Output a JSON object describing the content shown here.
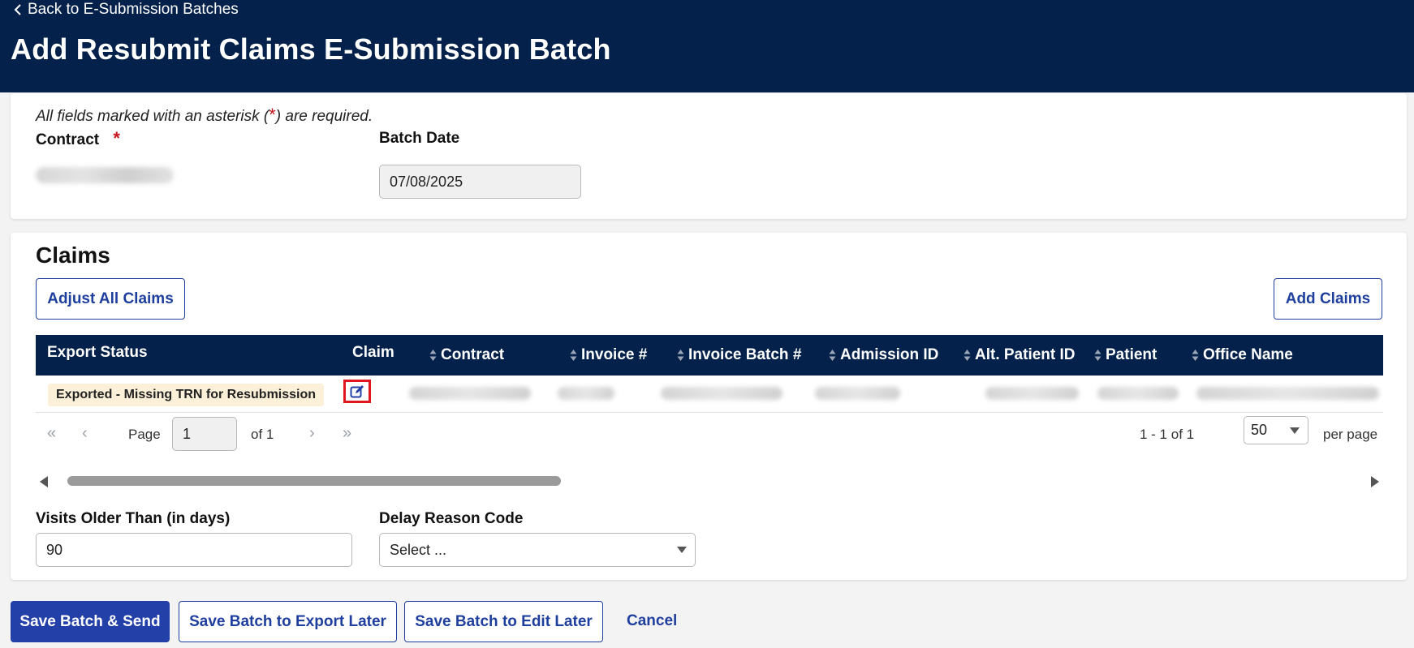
{
  "header": {
    "back_link": "Back to E-Submission Batches",
    "title": "Add Resubmit Claims E-Submission Batch"
  },
  "form": {
    "required_note_prefix": "All fields marked with an asterisk (",
    "required_note_asterisk": "*",
    "required_note_suffix": ") are required.",
    "contract_label": "Contract",
    "contract_required": "*",
    "batch_date_label": "Batch Date",
    "batch_date_value": "07/08/2025"
  },
  "claims": {
    "title": "Claims",
    "adjust_all_label": "Adjust All Claims",
    "add_claims_label": "Add Claims",
    "columns": [
      "Export Status",
      "Claim",
      "Contract",
      "Invoice #",
      "Invoice Batch #",
      "Admission ID",
      "Alt. Patient ID",
      "Patient",
      "Office Name"
    ],
    "rows": [
      {
        "export_status": "Exported - Missing TRN for Resubmission"
      }
    ],
    "pagination": {
      "page_label": "Page",
      "page_value": "1",
      "of_label": "of 1",
      "range_text": "1 - 1 of 1",
      "per_page_value": "50",
      "per_page_label": "per page"
    }
  },
  "options": {
    "visits_label": "Visits Older Than (in days)",
    "visits_value": "90",
    "delay_label": "Delay Reason Code",
    "delay_value": "Select ..."
  },
  "footer": {
    "save_send": "Save Batch & Send",
    "save_export_later": "Save Batch to Export Later",
    "save_edit_later": "Save Batch to Edit Later",
    "cancel": "Cancel"
  },
  "colors": {
    "header_bg": "#03214a",
    "primary": "#2240a8",
    "required": "#c4161c",
    "status_badge_bg": "#fdf0d9",
    "highlight_border": "#e0161e"
  },
  "icons": {
    "back": "chevron-left-icon",
    "sort": "sort-icon",
    "edit": "edit-icon",
    "first": "first-page-icon",
    "prev": "prev-page-icon",
    "next": "next-page-icon",
    "last": "last-page-icon"
  }
}
